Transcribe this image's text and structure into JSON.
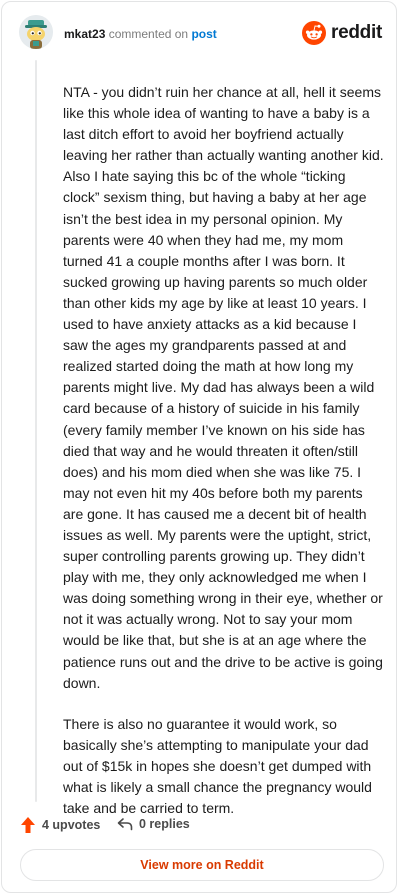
{
  "header": {
    "username": "mkat23",
    "verb": "commented on",
    "post_link": "post",
    "brand": "reddit"
  },
  "comment": {
    "paragraphs": [
      "NTA - you didn’t ruin her chance at all, hell it seems like this whole idea of wanting to have a baby is a last ditch effort to avoid her boyfriend actually leaving her rather than actually wanting another kid. Also I hate saying this bc of the whole “ticking clock” sexism thing, but having a baby at her age isn’t the best idea in my personal opinion. My parents were 40 when they had me, my mom turned 41 a couple months after I was born. It sucked growing up having parents so much older than other kids my age by like at least 10 years. I used to have anxiety attacks as a kid because I saw the ages my grandparents passed at and realized started doing the math at how long my parents might live. My dad has always been a wild card because of a history of suicide in his family (every family member I’ve known on his side has died that way and he would threaten it often/still does) and his mom died when she was like 75. I may not even hit my 40s before both my parents are gone. It has caused me a decent bit of health issues as well. My parents were the uptight, strict, super controlling parents growing up. They didn’t play with me, they only acknowledged me when I was doing something wrong in their eye, whether or not it was actually wrong. Not to say your mom would be like that, but she is at an age where the patience runs out and the drive to be active is going down.",
      "There is also no guarantee it would work, so basically she’s attempting to manipulate your dad out of $15k in hopes she doesn’t get dumped with what is likely a small chance the pregnancy would take and be carried to term."
    ]
  },
  "footer": {
    "upvotes": "4 upvotes",
    "replies": "0 replies",
    "view_more": "View more on Reddit"
  },
  "colors": {
    "brand_orange": "#ff4500",
    "link_blue": "#0079d3",
    "view_more_text": "#d93a00"
  },
  "icons": {
    "avatar": "snoo-avatar-icon",
    "logo": "reddit-logo-icon",
    "upvote": "upvote-arrow-icon",
    "reply": "reply-arrow-icon"
  }
}
